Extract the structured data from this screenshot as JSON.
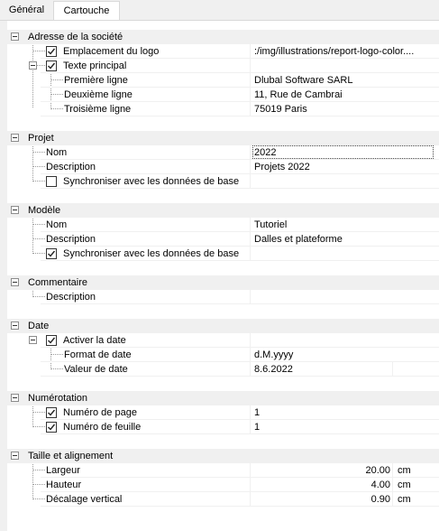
{
  "tabs": [
    {
      "label": "Général"
    },
    {
      "label": "Cartouche"
    }
  ],
  "sections": {
    "company": {
      "title": "Adresse de la société",
      "logo_label": "Emplacement du logo",
      "logo_value": ":/img/illustrations/report-logo-color....",
      "logo_checked": true,
      "text_label": "Texte principal",
      "text_checked": true,
      "line1_label": "Première ligne",
      "line1_value": "Dlubal Software SARL",
      "line2_label": "Deuxième ligne",
      "line2_value": "11, Rue de Cambrai",
      "line3_label": "Troisième ligne",
      "line3_value": "75019 Paris"
    },
    "project": {
      "title": "Projet",
      "name_label": "Nom",
      "name_value": "2022",
      "desc_label": "Description",
      "desc_value": "Projets 2022",
      "sync_label": "Synchroniser avec les données de base",
      "sync_checked": false
    },
    "model": {
      "title": "Modèle",
      "name_label": "Nom",
      "name_value": "Tutoriel",
      "desc_label": "Description",
      "desc_value": "Dalles et plateforme",
      "sync_label": "Synchroniser avec les données de base",
      "sync_checked": true
    },
    "comment": {
      "title": "Commentaire",
      "desc_label": "Description",
      "desc_value": ""
    },
    "date": {
      "title": "Date",
      "activate_label": "Activer la date",
      "activate_checked": true,
      "format_label": "Format de date",
      "format_value": "d.M.yyyy",
      "value_label": "Valeur de date",
      "value_value": "8.6.2022"
    },
    "numbering": {
      "title": "Numérotation",
      "page_label": "Numéro de page",
      "page_value": "1",
      "page_checked": true,
      "sheet_label": "Numéro de feuille",
      "sheet_value": "1",
      "sheet_checked": true
    },
    "size": {
      "title": "Taille et alignement",
      "width_label": "Largeur",
      "width_value": "20.00",
      "width_unit": "cm",
      "height_label": "Hauteur",
      "height_value": "4.00",
      "height_unit": "cm",
      "offset_label": "Décalage vertical",
      "offset_value": "0.90",
      "offset_unit": "cm"
    }
  }
}
